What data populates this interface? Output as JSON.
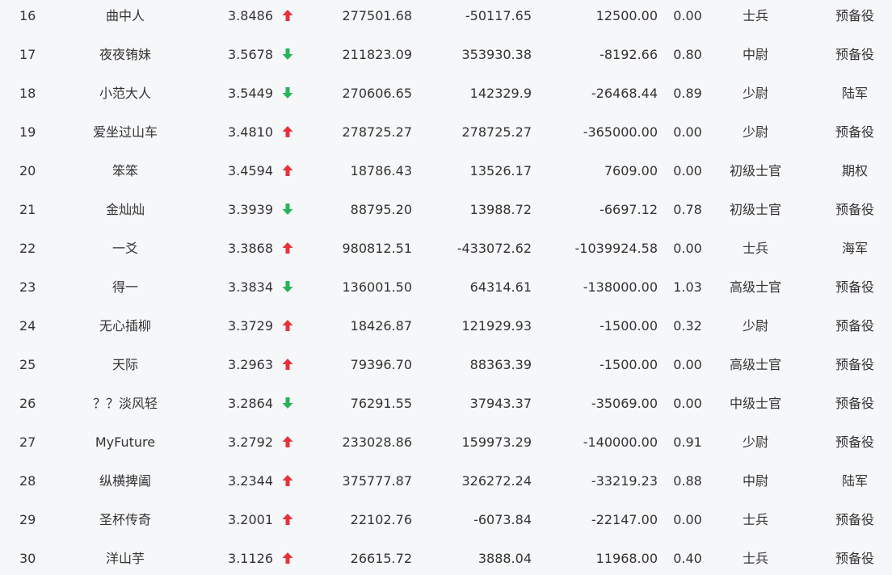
{
  "colors": {
    "up": "#e8323a",
    "down": "#27b35a",
    "text": "#333333",
    "background": "#f6f7f9"
  },
  "rows": [
    {
      "rank": "16",
      "name": "曲中人",
      "score": "3.8486",
      "trend": "up",
      "v1": "277501.68",
      "v2": "-50117.65",
      "v3": "12500.00",
      "v4": "0.00",
      "rank_title": "士兵",
      "type": "预备役"
    },
    {
      "rank": "17",
      "name": "夜夜铕妹",
      "score": "3.5678",
      "trend": "down",
      "v1": "211823.09",
      "v2": "353930.38",
      "v3": "-8192.66",
      "v4": "0.80",
      "rank_title": "中尉",
      "type": "预备役"
    },
    {
      "rank": "18",
      "name": "小范大人",
      "score": "3.5449",
      "trend": "down",
      "v1": "270606.65",
      "v2": "142329.9",
      "v3": "-26468.44",
      "v4": "0.89",
      "rank_title": "少尉",
      "type": "陆军"
    },
    {
      "rank": "19",
      "name": "爱坐过山车",
      "score": "3.4810",
      "trend": "up",
      "v1": "278725.27",
      "v2": "278725.27",
      "v3": "-365000.00",
      "v4": "0.00",
      "rank_title": "少尉",
      "type": "预备役"
    },
    {
      "rank": "20",
      "name": "笨笨",
      "score": "3.4594",
      "trend": "up",
      "v1": "18786.43",
      "v2": "13526.17",
      "v3": "7609.00",
      "v4": "0.00",
      "rank_title": "初级士官",
      "type": "期权"
    },
    {
      "rank": "21",
      "name": "金灿灿",
      "score": "3.3939",
      "trend": "down",
      "v1": "88795.20",
      "v2": "13988.72",
      "v3": "-6697.12",
      "v4": "0.78",
      "rank_title": "初级士官",
      "type": "预备役"
    },
    {
      "rank": "22",
      "name": "一爻",
      "score": "3.3868",
      "trend": "up",
      "v1": "980812.51",
      "v2": "-433072.62",
      "v3": "-1039924.58",
      "v4": "0.00",
      "rank_title": "士兵",
      "type": "海军"
    },
    {
      "rank": "23",
      "name": "得一",
      "score": "3.3834",
      "trend": "down",
      "v1": "136001.50",
      "v2": "64314.61",
      "v3": "-138000.00",
      "v4": "1.03",
      "rank_title": "高级士官",
      "type": "预备役"
    },
    {
      "rank": "24",
      "name": "无心插柳",
      "score": "3.3729",
      "trend": "up",
      "v1": "18426.87",
      "v2": "121929.93",
      "v3": "-1500.00",
      "v4": "0.32",
      "rank_title": "少尉",
      "type": "预备役"
    },
    {
      "rank": "25",
      "name": "天际",
      "score": "3.2963",
      "trend": "up",
      "v1": "79396.70",
      "v2": "88363.39",
      "v3": "-1500.00",
      "v4": "0.00",
      "rank_title": "高级士官",
      "type": "预备役"
    },
    {
      "rank": "26",
      "name": "？？淡风轻",
      "score": "3.2864",
      "trend": "down",
      "v1": "76291.55",
      "v2": "37943.37",
      "v3": "-35069.00",
      "v4": "0.00",
      "rank_title": "中级士官",
      "type": "预备役"
    },
    {
      "rank": "27",
      "name": "MyFuture",
      "score": "3.2792",
      "trend": "up",
      "v1": "233028.86",
      "v2": "159973.29",
      "v3": "-140000.00",
      "v4": "0.91",
      "rank_title": "少尉",
      "type": "预备役"
    },
    {
      "rank": "28",
      "name": "纵横捭阖",
      "score": "3.2344",
      "trend": "up",
      "v1": "375777.87",
      "v2": "326272.24",
      "v3": "-33219.23",
      "v4": "0.88",
      "rank_title": "中尉",
      "type": "陆军"
    },
    {
      "rank": "29",
      "name": "圣杯传奇",
      "score": "3.2001",
      "trend": "up",
      "v1": "22102.76",
      "v2": "-6073.84",
      "v3": "-22147.00",
      "v4": "0.00",
      "rank_title": "士兵",
      "type": "预备役"
    },
    {
      "rank": "30",
      "name": "洋山芋",
      "score": "3.1126",
      "trend": "up",
      "v1": "26615.72",
      "v2": "3888.04",
      "v3": "11968.00",
      "v4": "0.40",
      "rank_title": "士兵",
      "type": "预备役"
    }
  ]
}
